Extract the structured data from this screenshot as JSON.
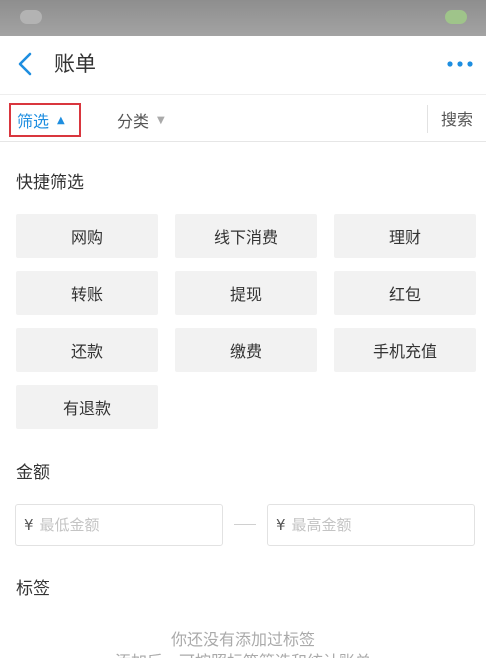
{
  "header": {
    "title": "账单",
    "back_icon": "chevron-left-icon",
    "more_icon": "more-dots-icon",
    "accent_color": "#1e8ee0"
  },
  "filter_bar": {
    "filter_label": "筛选",
    "category_label": "分类",
    "search_label": "搜索",
    "highlight_color": "#d9363e"
  },
  "quick_filter": {
    "title": "快捷筛选",
    "chips": [
      "网购",
      "线下消费",
      "理财",
      "转账",
      "提现",
      "红包",
      "还款",
      "缴费",
      "手机充值",
      "有退款"
    ]
  },
  "amount": {
    "title": "金额",
    "currency_symbol": "¥",
    "min_placeholder": "最低金额",
    "max_placeholder": "最高金额"
  },
  "tags": {
    "title": "标签",
    "empty_line1": "你还没有添加过标签",
    "empty_line2": "添加后，可按照标签筛选和统计账单"
  }
}
